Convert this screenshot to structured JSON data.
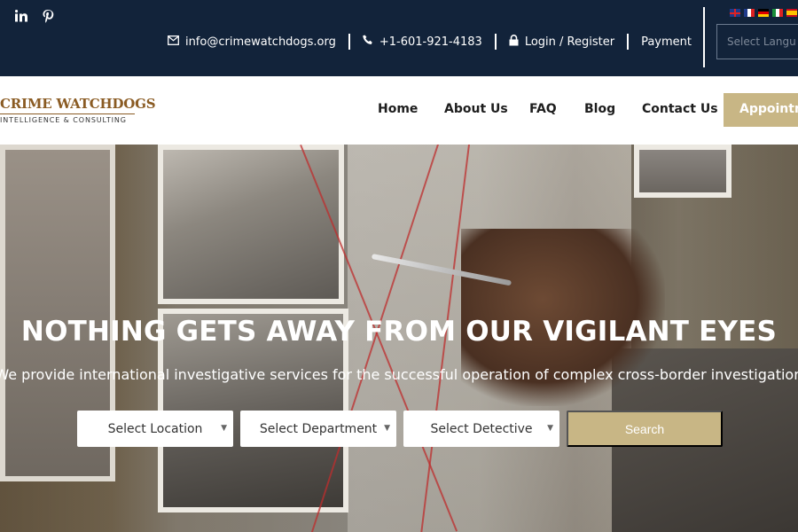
{
  "topbar": {
    "social": [
      {
        "icon": "linkedin-icon",
        "glyph": "in"
      },
      {
        "icon": "pinterest-icon",
        "glyph": "P"
      }
    ],
    "email": "info@crimewatchdogs.org",
    "phone": "+1-601-921-4183",
    "login": "Login / Register",
    "payment": "Payment",
    "language_placeholder": "Select Langu",
    "flags": [
      "english-flag-icon",
      "french-flag-icon",
      "german-flag-icon",
      "italian-flag-icon",
      "spanish-flag-icon"
    ]
  },
  "logo": {
    "title": "CRIME WATCHDOGS",
    "subtitle": "INTELLIGENCE & CONSULTING"
  },
  "nav": {
    "items": [
      "Home",
      "About Us",
      "FAQ",
      "Blog",
      "Contact Us"
    ],
    "cta": "Appointm"
  },
  "hero": {
    "title": "NOTHING GETS AWAY FROM OUR VIGILANT EYES",
    "subtitle": "We provide international investigative services for the successful operation of complex cross-border investigations"
  },
  "search": {
    "location": "Select Location",
    "department": "Select Department",
    "detective": "Select Detective",
    "button": "Search"
  },
  "colors": {
    "topbar_bg": "#12233a",
    "accent": "#c8b685",
    "logo": "#8a5b23"
  }
}
